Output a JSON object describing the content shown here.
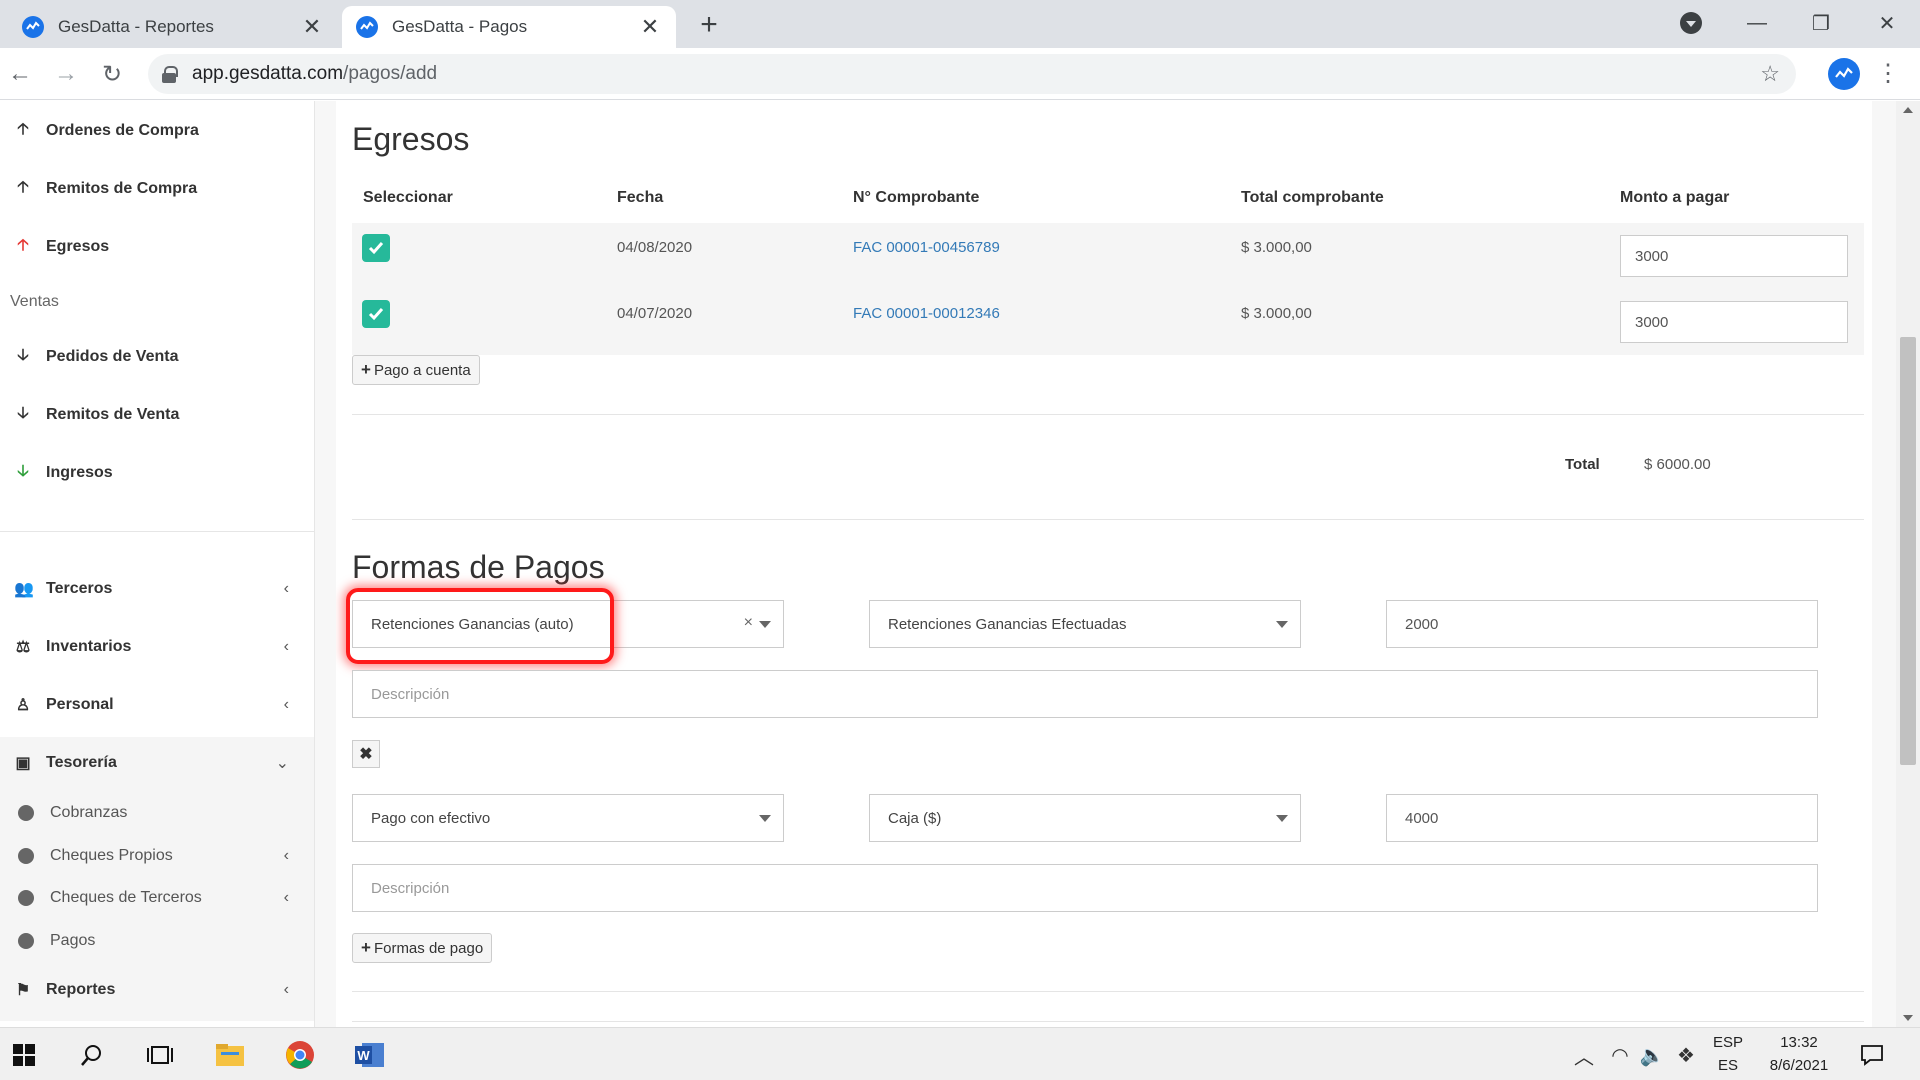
{
  "browser": {
    "tabs": [
      {
        "title": "GesDatta - Reportes",
        "active": false
      },
      {
        "title": "GesDatta - Pagos",
        "active": true
      }
    ],
    "url_host": "app.gesdatta.com",
    "url_path": "/pagos/add"
  },
  "sidebar": {
    "items_top": [
      {
        "label": "Ordenes de Compra",
        "icon": "arrow-up-icon"
      },
      {
        "label": "Remitos de Compra",
        "icon": "arrow-up-icon"
      },
      {
        "label": "Egresos",
        "icon": "arrow-up-red-icon"
      }
    ],
    "section_ventas": "Ventas",
    "items_ventas": [
      {
        "label": "Pedidos de Venta",
        "icon": "arrow-down-icon"
      },
      {
        "label": "Remitos de Venta",
        "icon": "arrow-down-icon"
      },
      {
        "label": "Ingresos",
        "icon": "arrow-down-green-icon"
      }
    ],
    "groups": [
      {
        "label": "Terceros",
        "icon": "users-icon"
      },
      {
        "label": "Inventarios",
        "icon": "scale-icon"
      },
      {
        "label": "Personal",
        "icon": "person-icon"
      },
      {
        "label": "Tesorería",
        "icon": "money-icon"
      }
    ],
    "tesoreria_sub": [
      {
        "label": "Cobranzas"
      },
      {
        "label": "Cheques Propios"
      },
      {
        "label": "Cheques de Terceros"
      },
      {
        "label": "Pagos"
      }
    ],
    "reportes": "Reportes"
  },
  "egresos": {
    "title": "Egresos",
    "headers": [
      "Seleccionar",
      "Fecha",
      "N° Comprobante",
      "Total comprobante",
      "Monto a pagar"
    ],
    "rows": [
      {
        "fecha": "04/08/2020",
        "comprobante": "FAC 00001-00456789",
        "total": "$ 3.000,00",
        "monto": "3000",
        "selected": true
      },
      {
        "fecha": "04/07/2020",
        "comprobante": "FAC 00001-00012346",
        "total": "$ 3.000,00",
        "monto": "3000",
        "selected": true
      }
    ],
    "pago_a_cuenta": "Pago a cuenta",
    "total_label": "Total",
    "total_value": "$ 6000.00"
  },
  "formas": {
    "title": "Formas de Pagos",
    "entries": [
      {
        "tipo": "Retenciones Ganancias (auto)",
        "cuenta": "Retenciones Ganancias Efectuadas",
        "monto": "2000",
        "descripcion_placeholder": "Descripción"
      },
      {
        "tipo": "Pago con efectivo",
        "cuenta": "Caja ($)",
        "monto": "4000",
        "descripcion_placeholder": "Descripción"
      }
    ],
    "add_button": "Formas de pago"
  },
  "taskbar": {
    "lang_top": "ESP",
    "lang_bottom": "ES",
    "time": "13:32",
    "date": "8/6/2021"
  },
  "colors": {
    "accent_check": "#26b99a",
    "link": "#337ab7",
    "highlight": "#ff1a1a"
  }
}
